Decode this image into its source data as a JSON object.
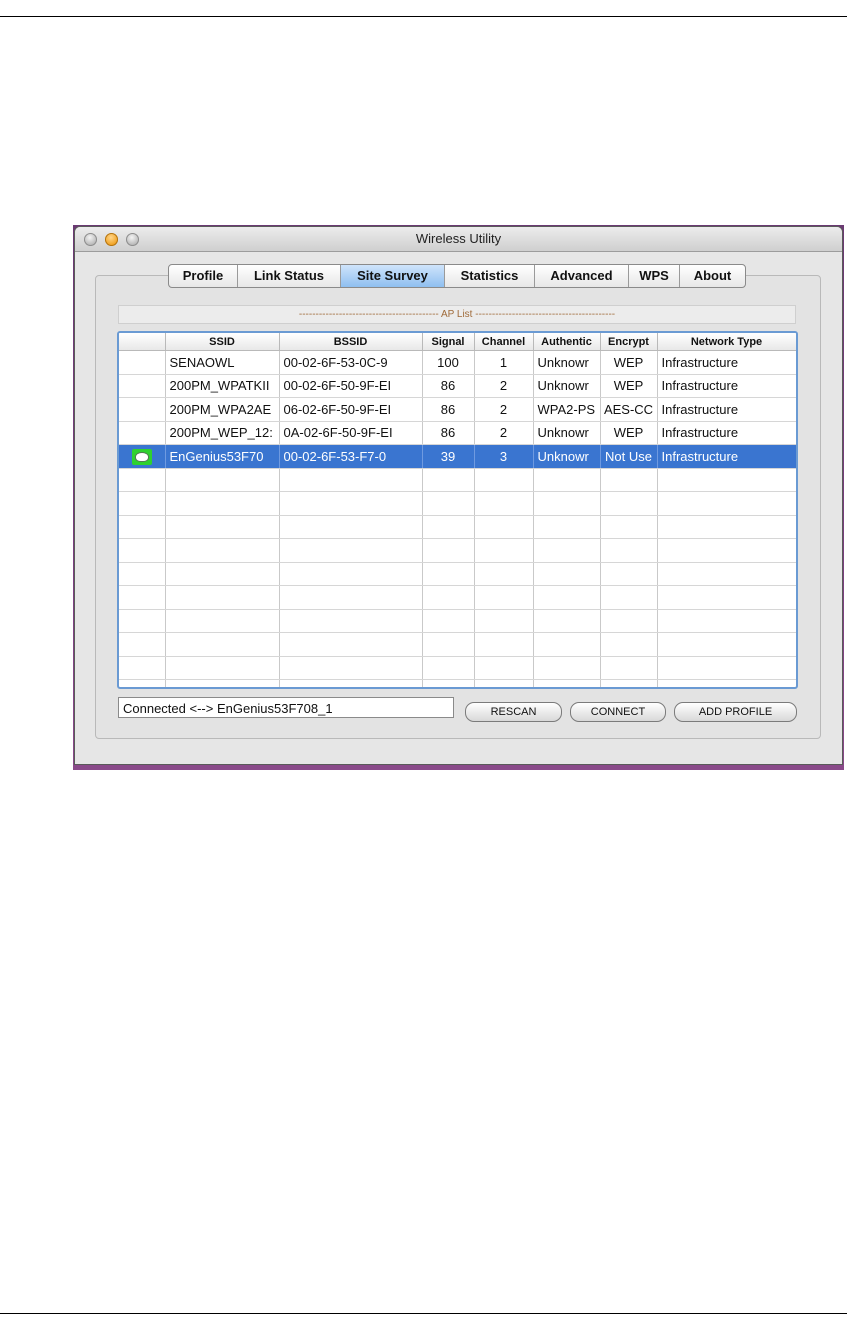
{
  "window": {
    "title": "Wireless Utility"
  },
  "tabs": [
    {
      "label": "Profile"
    },
    {
      "label": "Link Status"
    },
    {
      "label": "Site Survey",
      "active": true
    },
    {
      "label": "Statistics"
    },
    {
      "label": "Advanced"
    },
    {
      "label": "WPS"
    },
    {
      "label": "About"
    }
  ],
  "ap_list": {
    "header": "------------------------------------------ AP List ------------------------------------------",
    "columns": [
      "",
      "SSID",
      "BSSID",
      "Signal",
      "Channel",
      "Authentic",
      "Encrypt",
      "Network Type"
    ],
    "rows": [
      {
        "icon": "",
        "ssid": "SENAOWL",
        "bssid": "00-02-6F-53-0C-9",
        "signal": "100",
        "channel": "1",
        "auth": "Unknowr",
        "encrypt": "WEP",
        "type": "Infrastructure"
      },
      {
        "icon": "",
        "ssid": "200PM_WPATKII",
        "bssid": "00-02-6F-50-9F-EI",
        "signal": "86",
        "channel": "2",
        "auth": "Unknowr",
        "encrypt": "WEP",
        "type": "Infrastructure"
      },
      {
        "icon": "",
        "ssid": "200PM_WPA2AE",
        "bssid": "06-02-6F-50-9F-EI",
        "signal": "86",
        "channel": "2",
        "auth": "WPA2-PS",
        "encrypt": "AES-CC",
        "type": "Infrastructure"
      },
      {
        "icon": "",
        "ssid": "200PM_WEP_12:",
        "bssid": "0A-02-6F-50-9F-EI",
        "signal": "86",
        "channel": "2",
        "auth": "Unknowr",
        "encrypt": "WEP",
        "type": "Infrastructure"
      },
      {
        "icon": "connected-icon",
        "ssid": "EnGenius53F70",
        "bssid": "00-02-6F-53-F7-0",
        "signal": "39",
        "channel": "3",
        "auth": "Unknowr",
        "encrypt": "Not Use",
        "type": "Infrastructure",
        "selected": true
      }
    ],
    "empty_rows": 10
  },
  "status": {
    "text": "Connected <--> EnGenius53F708_1"
  },
  "buttons": {
    "rescan": "RESCAN",
    "connect": "CONNECT",
    "add_profile": "ADD PROFILE"
  },
  "colors": {
    "selection": "#3a75d0",
    "tab_active": "#8fbff0",
    "table_border": "#6a9ad3"
  }
}
